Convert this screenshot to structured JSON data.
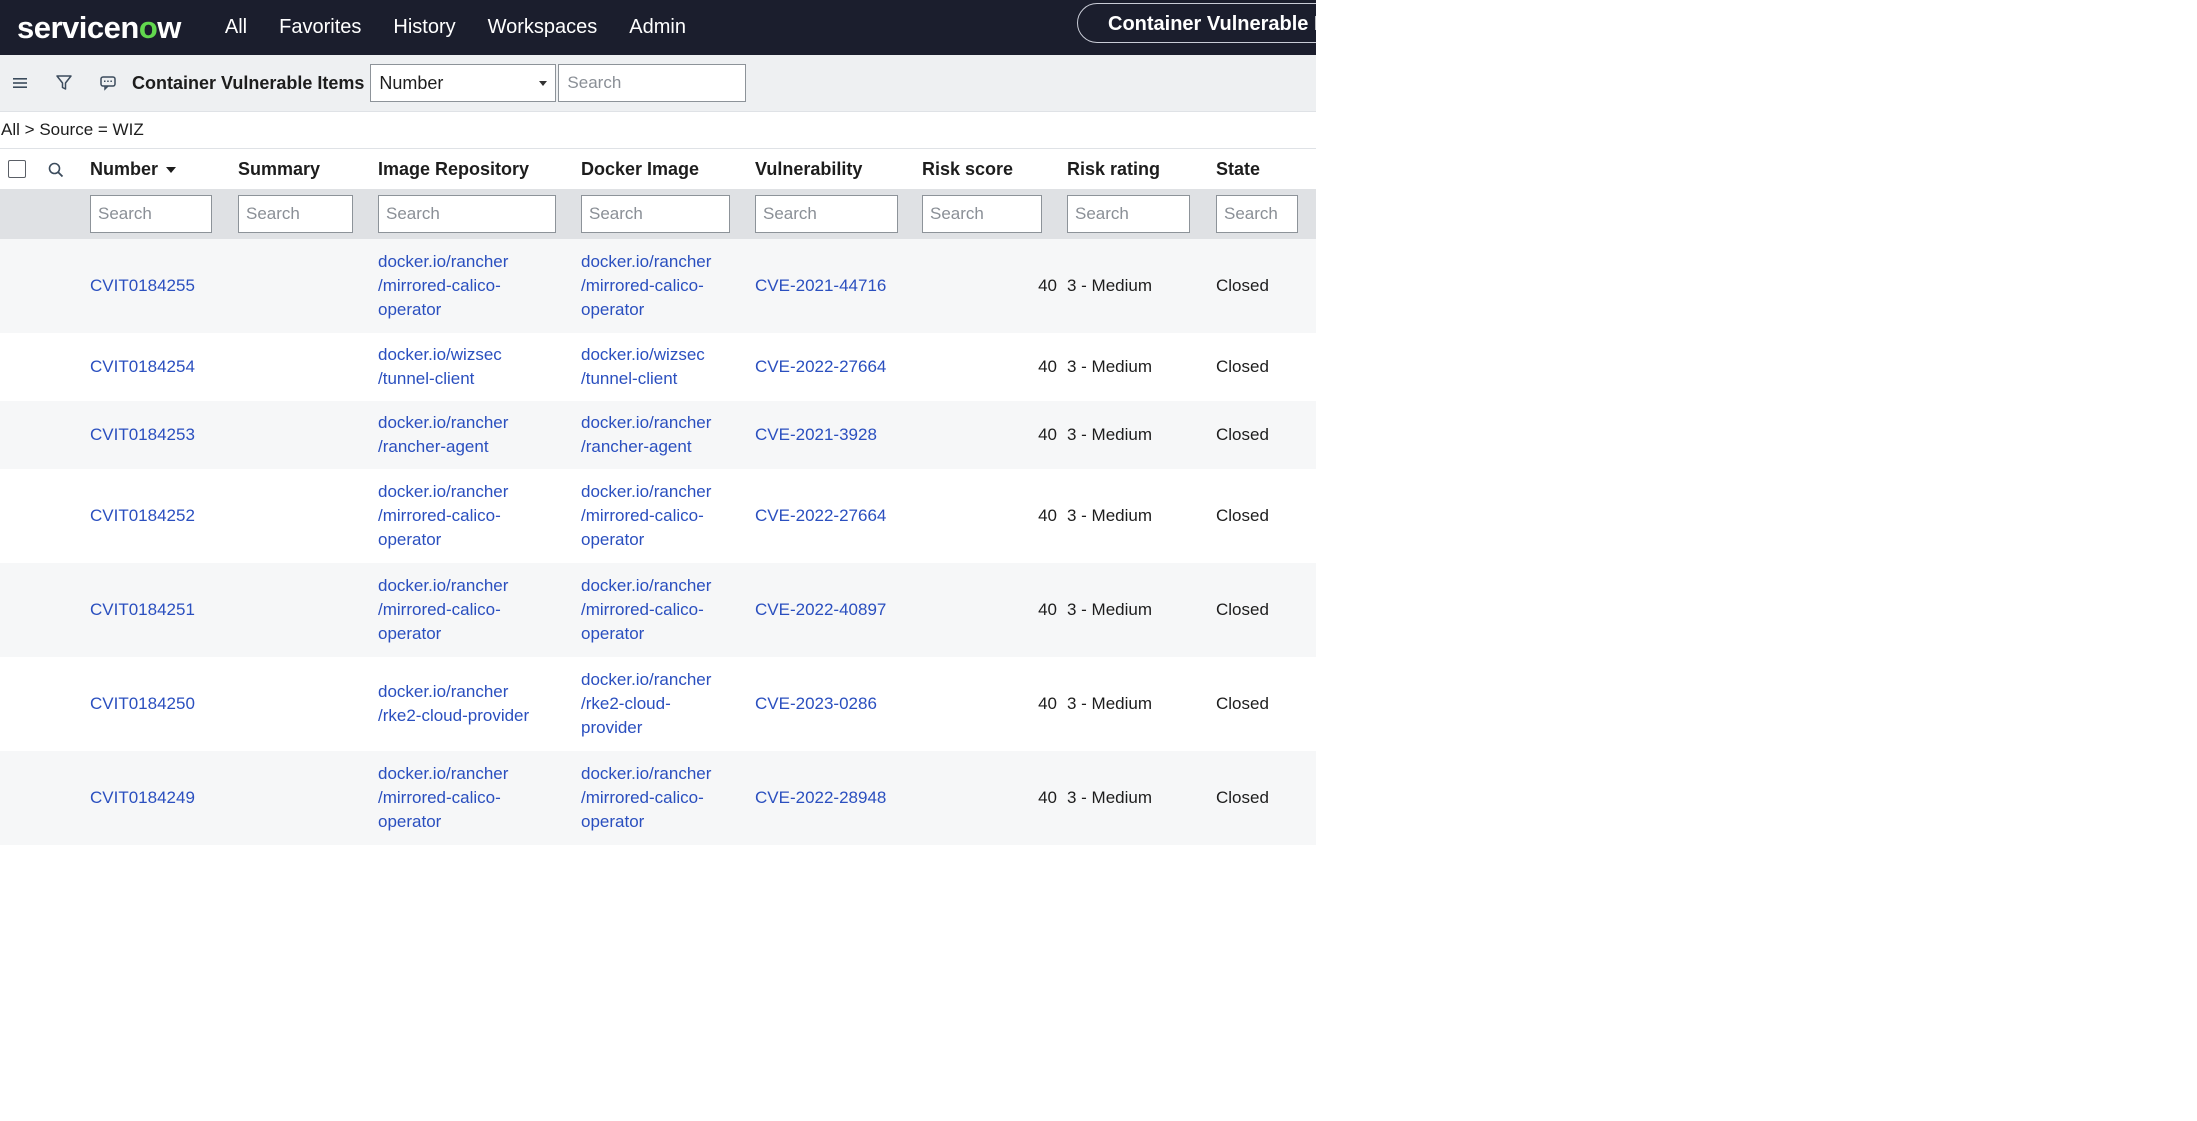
{
  "nav": {
    "logo_pre": "servicen",
    "logo_o": "o",
    "logo_post": "w",
    "items": [
      "All",
      "Favorites",
      "History",
      "Workspaces",
      "Admin"
    ],
    "context_pill": "Container Vulnerable It"
  },
  "listbar": {
    "title": "Container Vulnerable Items",
    "field_select": "Number",
    "search_placeholder": "Search"
  },
  "breadcrumb": {
    "root": "All",
    "sep": ">",
    "condition": "Source = WIZ"
  },
  "table": {
    "columns": [
      "Number",
      "Summary",
      "Image Repository",
      "Docker Image",
      "Vulnerability",
      "Risk score",
      "Risk rating",
      "State"
    ],
    "search_placeholder": "Search",
    "rows": [
      {
        "number": "CVIT0184255",
        "summary": "",
        "image_repository": "docker.io/rancher\n/mirrored-calico-\noperator",
        "docker_image": "docker.io/rancher\n/mirrored-calico-\noperator",
        "vulnerability": "CVE-2021-44716",
        "risk_score": "40",
        "risk_rating": "3 - Medium",
        "state": "Closed"
      },
      {
        "number": "CVIT0184254",
        "summary": "",
        "image_repository": "docker.io/wizsec\n/tunnel-client",
        "docker_image": "docker.io/wizsec\n/tunnel-client",
        "vulnerability": "CVE-2022-27664",
        "risk_score": "40",
        "risk_rating": "3 - Medium",
        "state": "Closed"
      },
      {
        "number": "CVIT0184253",
        "summary": "",
        "image_repository": "docker.io/rancher\n/rancher-agent",
        "docker_image": "docker.io/rancher\n/rancher-agent",
        "vulnerability": "CVE-2021-3928",
        "risk_score": "40",
        "risk_rating": "3 - Medium",
        "state": "Closed"
      },
      {
        "number": "CVIT0184252",
        "summary": "",
        "image_repository": "docker.io/rancher\n/mirrored-calico-\noperator",
        "docker_image": "docker.io/rancher\n/mirrored-calico-\noperator",
        "vulnerability": "CVE-2022-27664",
        "risk_score": "40",
        "risk_rating": "3 - Medium",
        "state": "Closed"
      },
      {
        "number": "CVIT0184251",
        "summary": "",
        "image_repository": "docker.io/rancher\n/mirrored-calico-\noperator",
        "docker_image": "docker.io/rancher\n/mirrored-calico-\noperator",
        "vulnerability": "CVE-2022-40897",
        "risk_score": "40",
        "risk_rating": "3 - Medium",
        "state": "Closed"
      },
      {
        "number": "CVIT0184250",
        "summary": "",
        "image_repository": "docker.io/rancher\n/rke2-cloud-provider",
        "docker_image": "docker.io/rancher\n/rke2-cloud-\nprovider",
        "vulnerability": "CVE-2023-0286",
        "risk_score": "40",
        "risk_rating": "3 - Medium",
        "state": "Closed"
      },
      {
        "number": "CVIT0184249",
        "summary": "",
        "image_repository": "docker.io/rancher\n/mirrored-calico-\noperator",
        "docker_image": "docker.io/rancher\n/mirrored-calico-\noperator",
        "vulnerability": "CVE-2022-28948",
        "risk_score": "40",
        "risk_rating": "3 - Medium",
        "state": "Closed"
      }
    ]
  },
  "colors": {
    "nav_bg": "#1b1e2d",
    "logo_accent": "#62d84e",
    "link": "#2a4fbf",
    "filter_row_bg": "#dfe1e4"
  }
}
